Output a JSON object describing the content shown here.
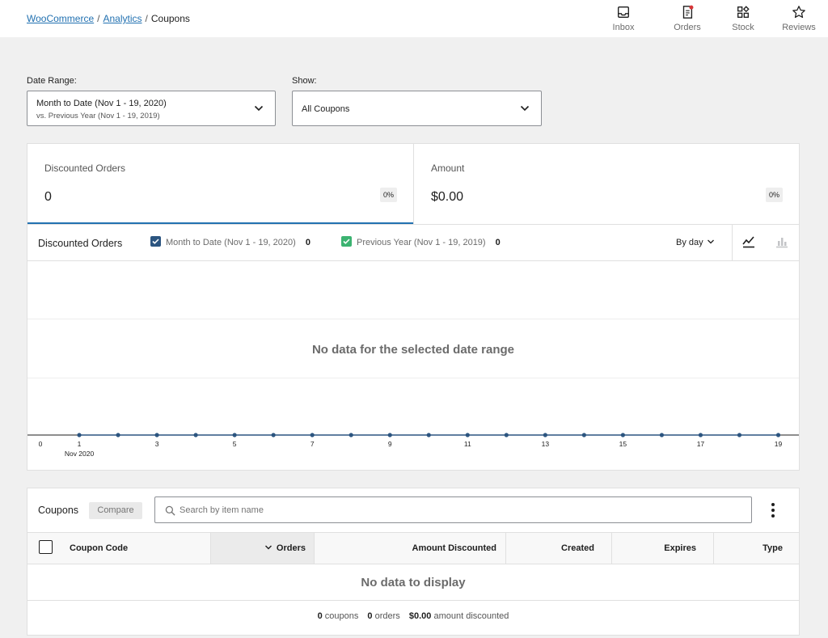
{
  "breadcrumb": {
    "items": [
      "WooCommerce",
      "Analytics"
    ],
    "current": "Coupons"
  },
  "header_actions": [
    {
      "label": "Inbox",
      "icon": "inbox-icon"
    },
    {
      "label": "Orders",
      "icon": "orders-icon",
      "badge_color": "#d63638"
    },
    {
      "label": "Stock",
      "icon": "stock-icon"
    },
    {
      "label": "Reviews",
      "icon": "star-icon"
    }
  ],
  "filters": {
    "date_range": {
      "label": "Date Range:",
      "value": "Month to Date (Nov 1 - 19, 2020)",
      "compare": "vs. Previous Year (Nov 1 - 19, 2019)"
    },
    "show": {
      "label": "Show:",
      "value": "All Coupons"
    }
  },
  "summary": [
    {
      "label": "Discounted Orders",
      "value": "0",
      "delta": "0%",
      "active": true
    },
    {
      "label": "Amount",
      "value": "$0.00",
      "delta": "0%",
      "active": false
    }
  ],
  "chart": {
    "title": "Discounted Orders",
    "legend": [
      {
        "label": "Month to Date (Nov 1 - 19, 2020)",
        "value": "0",
        "color": "#2c5580"
      },
      {
        "label": "Previous Year (Nov 1 - 19, 2019)",
        "value": "0",
        "color": "#3cb371"
      }
    ],
    "interval": "By day",
    "no_data": "No data for the selected date range",
    "x_tick_labels": [
      "0",
      "1",
      "3",
      "5",
      "7",
      "9",
      "11",
      "13",
      "15",
      "17",
      "19"
    ],
    "x_month_label": "Nov 2020"
  },
  "chart_data": {
    "type": "line",
    "title": "Discounted Orders",
    "x": [
      1,
      2,
      3,
      4,
      5,
      6,
      7,
      8,
      9,
      10,
      11,
      12,
      13,
      14,
      15,
      16,
      17,
      18,
      19
    ],
    "xlabel": "",
    "ylabel": "",
    "series": [
      {
        "name": "Month to Date (Nov 1 - 19, 2020)",
        "values": [
          0,
          0,
          0,
          0,
          0,
          0,
          0,
          0,
          0,
          0,
          0,
          0,
          0,
          0,
          0,
          0,
          0,
          0,
          0
        ],
        "color": "#2c5580"
      }
    ],
    "xlim": [
      0,
      19
    ],
    "grid": true,
    "legend_position": "top"
  },
  "table": {
    "title": "Coupons",
    "compare_label": "Compare",
    "search_placeholder": "Search by item name",
    "columns": [
      "Coupon Code",
      "Orders",
      "Amount Discounted",
      "Created",
      "Expires",
      "Type"
    ],
    "sorted_column": "Orders",
    "empty_message": "No data to display",
    "summary": [
      {
        "value": "0",
        "label": "coupons"
      },
      {
        "value": "0",
        "label": "orders"
      },
      {
        "value": "$0.00",
        "label": "amount discounted"
      }
    ]
  }
}
